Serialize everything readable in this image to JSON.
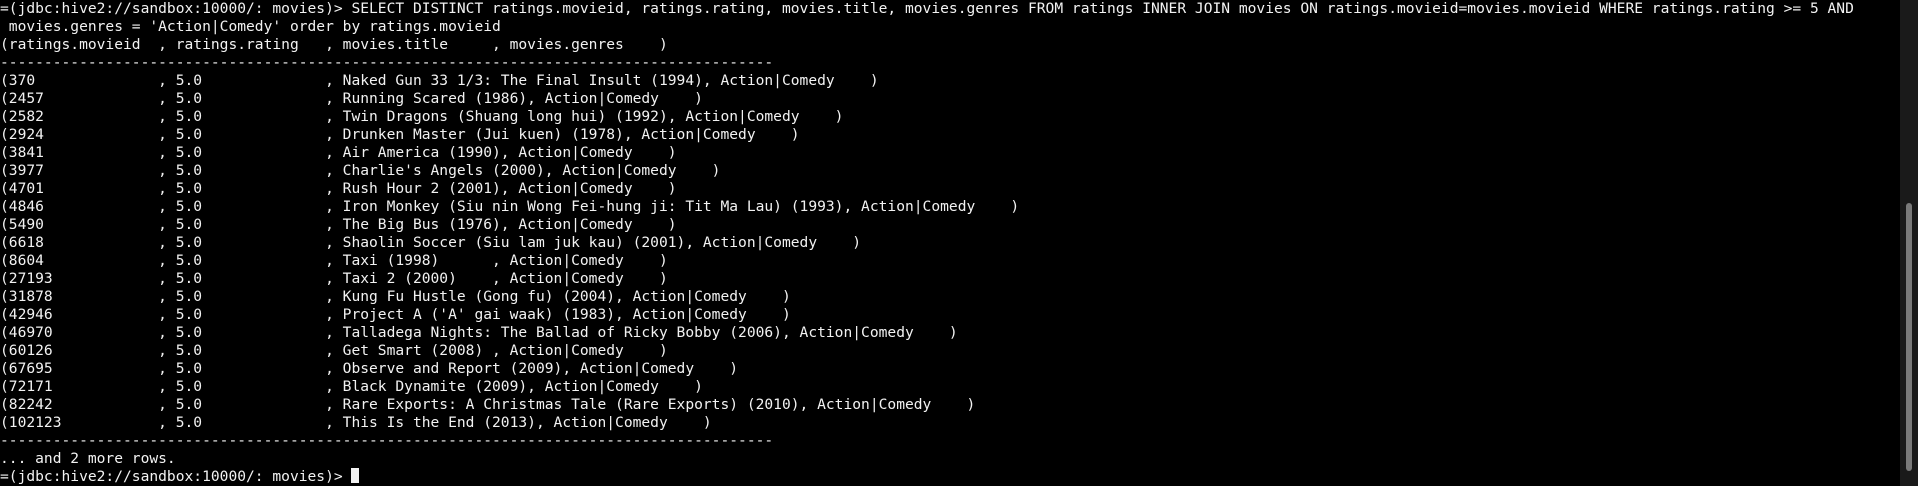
{
  "terminal": {
    "query_line_1": "=(jdbc:hive2://sandbox:10000/: movies)> SELECT DISTINCT ratings.movieid, ratings.rating, movies.title, movies.genres FROM ratings INNER JOIN movies ON ratings.movieid=movies.movieid WHERE ratings.rating >= 5 AND",
    "query_line_2": " movies.genres = 'Action|Comedy' order by ratings.movieid",
    "header": "(ratings.movieid  , ratings.rating   , movies.title     , movies.genres    )",
    "separator": "----------------------------------------------------------------------------------------",
    "rows": [
      "(370              , 5.0              , Naked Gun 33 1/3: The Final Insult (1994), Action|Comedy    )",
      "(2457             , 5.0              , Running Scared (1986), Action|Comedy    )",
      "(2582             , 5.0              , Twin Dragons (Shuang long hui) (1992), Action|Comedy    )",
      "(2924             , 5.0              , Drunken Master (Jui kuen) (1978), Action|Comedy    )",
      "(3841             , 5.0              , Air America (1990), Action|Comedy    )",
      "(3977             , 5.0              , Charlie's Angels (2000), Action|Comedy    )",
      "(4701             , 5.0              , Rush Hour 2 (2001), Action|Comedy    )",
      "(4846             , 5.0              , Iron Monkey (Siu nin Wong Fei-hung ji: Tit Ma Lau) (1993), Action|Comedy    )",
      "(5490             , 5.0              , The Big Bus (1976), Action|Comedy    )",
      "(6618             , 5.0              , Shaolin Soccer (Siu lam juk kau) (2001), Action|Comedy    )",
      "(8604             , 5.0              , Taxi (1998)      , Action|Comedy    )",
      "(27193            , 5.0              , Taxi 2 (2000)    , Action|Comedy    )",
      "(31878            , 5.0              , Kung Fu Hustle (Gong fu) (2004), Action|Comedy    )",
      "(42946            , 5.0              , Project A ('A' gai waak) (1983), Action|Comedy    )",
      "(46970            , 5.0              , Talladega Nights: The Ballad of Ricky Bobby (2006), Action|Comedy    )",
      "(60126            , 5.0              , Get Smart (2008) , Action|Comedy    )",
      "(67695            , 5.0              , Observe and Report (2009), Action|Comedy    )",
      "(72171            , 5.0              , Black Dynamite (2009), Action|Comedy    )",
      "(82242            , 5.0              , Rare Exports: A Christmas Tale (Rare Exports) (2010), Action|Comedy    )",
      "(102123           , 5.0              , This Is the End (2013), Action|Comedy    )"
    ],
    "more_rows": "... and 2 more rows.",
    "prompt": "=(jdbc:hive2://sandbox:10000/: movies)> "
  },
  "colors": {
    "background": "#000000",
    "foreground": "#f2f2f2",
    "scroll_thumb": "#7a7a7a"
  }
}
